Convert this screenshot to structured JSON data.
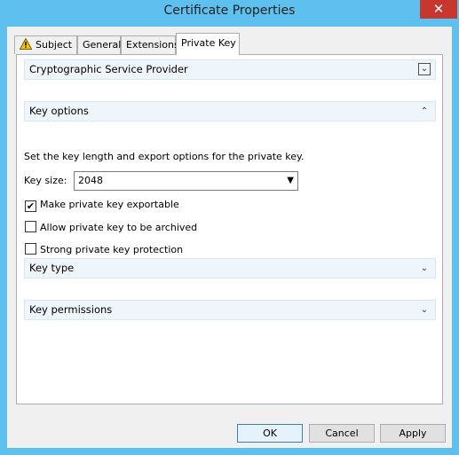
{
  "window": {
    "title": "Certificate Properties",
    "close_glyph": "✕"
  },
  "tabs": [
    {
      "label": "Subject",
      "icon": "warning-icon"
    },
    {
      "label": "General"
    },
    {
      "label": "Extensions"
    },
    {
      "label": "Private Key"
    }
  ],
  "sections": {
    "csp": {
      "label": "Cryptographic Service Provider",
      "state": "collapsed"
    },
    "key_options": {
      "label": "Key options",
      "state": "expanded",
      "description": "Set the key length and export options for the private key.",
      "key_size_label": "Key size:",
      "key_size_value": "2048",
      "checkboxes": [
        {
          "label": "Make private key exportable",
          "checked": true
        },
        {
          "label": "Allow private key to be archived",
          "checked": false
        },
        {
          "label": "Strong private key protection",
          "checked": false
        }
      ]
    },
    "key_type": {
      "label": "Key type",
      "state": "collapsed"
    },
    "key_permissions": {
      "label": "Key permissions",
      "state": "collapsed"
    }
  },
  "buttons": {
    "ok": "OK",
    "cancel": "Cancel",
    "apply": "Apply"
  },
  "glyphs": {
    "chevron_down": "⌄",
    "chevron_up": "⌃",
    "check": "✔",
    "dropdown": "▼"
  },
  "colors": {
    "titlebar": "#5ec0ee",
    "close": "#c7372f",
    "section_bg": "#eef5fb"
  }
}
